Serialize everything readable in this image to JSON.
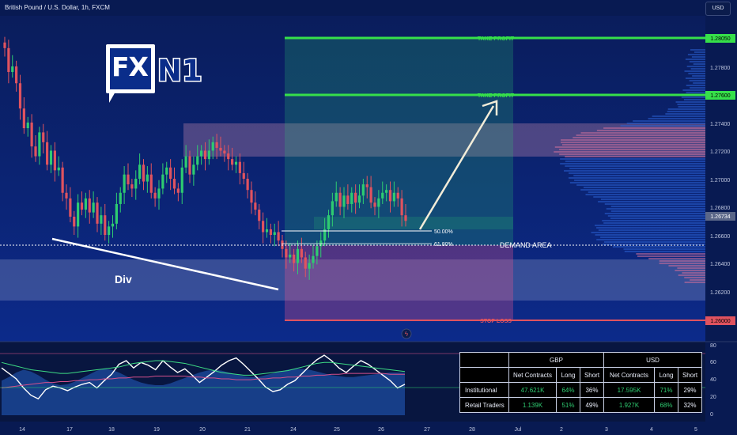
{
  "header": {
    "symbol_title": "British Pound / U.S. Dollar, 1h, FXCM",
    "currency": "USD"
  },
  "logo": {
    "part1": "FX",
    "part2": "N1"
  },
  "chart_data": [
    {
      "type": "candlestick",
      "x_ticks": [
        "14",
        "17",
        "18",
        "19",
        "20",
        "21",
        "24",
        "25",
        "26",
        "27",
        "28",
        "Jul",
        "2",
        "3",
        "4",
        "5"
      ],
      "y_ticks": [
        "1.28000",
        "1.27800",
        "1.27600",
        "1.27400",
        "1.27200",
        "1.27000",
        "1.26800",
        "1.26600",
        "1.26400",
        "1.26200",
        "1.26000"
      ],
      "ylim": [
        1.2586,
        1.2818
      ],
      "current_price": "1.26734",
      "price_labels": [
        {
          "text": "1.28050",
          "value": 1.2805,
          "color": "#2ecc40"
        },
        {
          "text": "1.27600",
          "value": 1.276,
          "color": "#2ecc40"
        },
        {
          "text": "1.26734",
          "value": 1.26734,
          "color": "#6a7799"
        },
        {
          "text": "1.26000",
          "value": 1.26,
          "color": "#e0535f"
        }
      ],
      "close_series": [
        1.2795,
        1.2778,
        1.2782,
        1.277,
        1.2752,
        1.2738,
        1.2742,
        1.2725,
        1.2718,
        1.2735,
        1.2728,
        1.2712,
        1.2722,
        1.2708,
        1.271,
        1.2692,
        1.2688,
        1.2675,
        1.2668,
        1.2685,
        1.268,
        1.2688,
        1.2678,
        1.2685,
        1.267,
        1.2676,
        1.2662,
        1.2668,
        1.267,
        1.2684,
        1.2692,
        1.2705,
        1.2698,
        1.2695,
        1.2702,
        1.2712,
        1.27,
        1.2705,
        1.2692,
        1.2688,
        1.2695,
        1.2705,
        1.271,
        1.2702,
        1.2695,
        1.2692,
        1.271,
        1.2718,
        1.2705,
        1.2712,
        1.2718,
        1.2722,
        1.2716,
        1.2722,
        1.2728,
        1.2724,
        1.2722,
        1.272,
        1.2716,
        1.2712,
        1.2714,
        1.2706,
        1.2702,
        1.2694,
        1.2685,
        1.268,
        1.2672,
        1.2664,
        1.2666,
        1.2662,
        1.2664,
        1.2658,
        1.2652,
        1.2646,
        1.2648,
        1.2642,
        1.2652,
        1.2646,
        1.2638,
        1.2642,
        1.2647,
        1.2654,
        1.2658,
        1.2666,
        1.2676,
        1.2686,
        1.2692,
        1.2682,
        1.269,
        1.2684,
        1.2692,
        1.2685,
        1.269,
        1.2698,
        1.2696,
        1.2685,
        1.2682,
        1.2688,
        1.2692,
        1.2694,
        1.2686,
        1.2692,
        1.2688,
        1.2676,
        1.2672
      ],
      "annotations": {
        "take_profit": [
          "TAKE PROFIT",
          "TAKE PROFIT"
        ],
        "stop_loss": "STOP LOSS",
        "fib_50": "50.00%",
        "fib_618": "61.80%",
        "demand_area": "DEMAND AREA",
        "divergence": "Div"
      },
      "levels": {
        "take_profit_1": 1.2805,
        "take_profit_2": 1.276,
        "stop_loss": 1.26,
        "fib_50": 1.2664,
        "fib_618": 1.2652,
        "demand_area": 1.2654
      },
      "grid": false
    },
    {
      "type": "line",
      "name": "oscillator",
      "y_ticks": [
        "80",
        "60",
        "40",
        "20",
        "0"
      ],
      "ylim": [
        0,
        80
      ],
      "series": [
        {
          "name": "",
          "color": "#ffffff",
          "values": [
            52,
            46,
            40,
            30,
            22,
            18,
            28,
            32,
            30,
            27,
            31,
            34,
            36,
            30,
            38,
            45,
            56,
            60,
            52,
            58,
            55,
            50,
            60,
            53,
            47,
            51,
            44,
            36,
            42,
            48,
            55,
            60,
            63,
            56,
            48,
            40,
            31,
            26,
            28,
            34,
            38,
            46,
            54,
            61,
            66,
            60,
            52,
            47,
            54,
            60,
            56,
            50,
            44,
            38,
            30,
            34
          ]
        },
        {
          "name": "",
          "color": "#3ddc84",
          "values": [
            58,
            56,
            54,
            52,
            50,
            49,
            48,
            47,
            46,
            46,
            47,
            48,
            49,
            50,
            51,
            52,
            53,
            55,
            57,
            58,
            59,
            60,
            60,
            59,
            58,
            57,
            55,
            53,
            51,
            49,
            47,
            46,
            45,
            44,
            44,
            45,
            46,
            47,
            48,
            49,
            51,
            53,
            55,
            57,
            58,
            58,
            57,
            56,
            55,
            54,
            53,
            52,
            51,
            50,
            49,
            48
          ]
        },
        {
          "name": "",
          "color": "#d4508c",
          "values": [
            30,
            31,
            32,
            33,
            34,
            35,
            36,
            36,
            37,
            37,
            38,
            38,
            39,
            39,
            40,
            40,
            41,
            41,
            42,
            42,
            42,
            43,
            43,
            43,
            43,
            43,
            42,
            42,
            41,
            41,
            40,
            40,
            39,
            39,
            39,
            40,
            40,
            41,
            41,
            42,
            42,
            43,
            43,
            44,
            44,
            45,
            45,
            46,
            46,
            46,
            46,
            46,
            46,
            45,
            45,
            45
          ]
        }
      ],
      "band_series": [
        38,
        42,
        47,
        50,
        48,
        44,
        39,
        35,
        33,
        34,
        37,
        41,
        45,
        49,
        51,
        50,
        47,
        43,
        39,
        36,
        34,
        33,
        33,
        35,
        38,
        41,
        44,
        47,
        49,
        50,
        49,
        47,
        45,
        43,
        42,
        42,
        44,
        46,
        48,
        50,
        51,
        51,
        50,
        48,
        46,
        44,
        43,
        42,
        42,
        43,
        44,
        45,
        46,
        47,
        47,
        47
      ]
    }
  ],
  "table": {
    "headers": [
      "",
      "GBP",
      "USD"
    ],
    "subheaders": [
      "",
      "Net Contracts",
      "Long",
      "Short",
      "Net Contracts",
      "Long",
      "Short"
    ],
    "rows": [
      [
        "Institutional",
        "47.621K",
        "64%",
        "36%",
        "17.595K",
        "71%",
        "29%"
      ],
      [
        "Retail Traders",
        "1.139K",
        "51%",
        "49%",
        "1.927K",
        "68%",
        "32%"
      ]
    ]
  },
  "colors": {
    "background": "#081a52",
    "bull": "#2ecc71",
    "bear": "#e0535f",
    "take_profit": "#36e04a",
    "stop_loss": "#e0535f"
  }
}
